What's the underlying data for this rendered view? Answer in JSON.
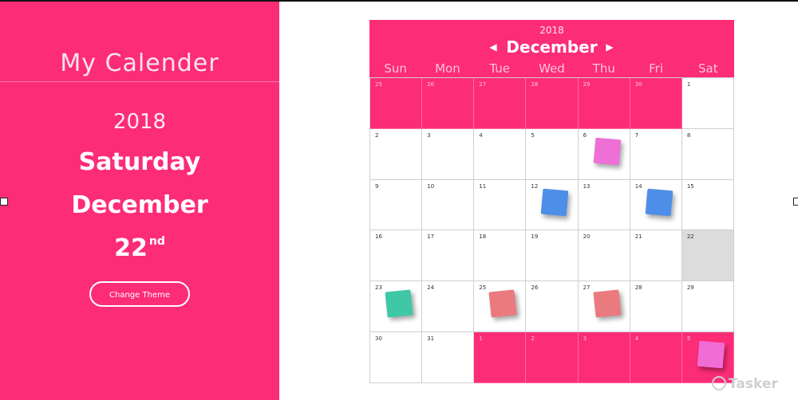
{
  "sidebar": {
    "app_title": "My Calender",
    "year": "2018",
    "weekday": "Saturday",
    "month": "December",
    "day": "22",
    "day_suffix": "nd",
    "theme_button": "Change Theme",
    "background_color": "#fd2c77"
  },
  "calendar": {
    "year": "2018",
    "month": "December",
    "prev_icon": "chevron-left-icon",
    "next_icon": "chevron-right-icon",
    "weekdays": [
      "Sun",
      "Mon",
      "Tue",
      "Wed",
      "Thu",
      "Fri",
      "Sat"
    ],
    "accent_color": "#fd2c77",
    "today_color": "#dcdcdc",
    "cells": [
      {
        "label": "25",
        "muted": true
      },
      {
        "label": "26",
        "muted": true
      },
      {
        "label": "27",
        "muted": true
      },
      {
        "label": "28",
        "muted": true
      },
      {
        "label": "29",
        "muted": true
      },
      {
        "label": "30",
        "muted": true
      },
      {
        "label": "1",
        "muted": false
      },
      {
        "label": "2",
        "muted": false
      },
      {
        "label": "3",
        "muted": false
      },
      {
        "label": "4",
        "muted": false
      },
      {
        "label": "5",
        "muted": false
      },
      {
        "label": "6",
        "muted": false,
        "note": "#ee6fd6"
      },
      {
        "label": "7",
        "muted": false
      },
      {
        "label": "8",
        "muted": false
      },
      {
        "label": "9",
        "muted": false
      },
      {
        "label": "10",
        "muted": false
      },
      {
        "label": "11",
        "muted": false
      },
      {
        "label": "12",
        "muted": false,
        "note": "#4d8fe8"
      },
      {
        "label": "13",
        "muted": false
      },
      {
        "label": "14",
        "muted": false,
        "note": "#4d8fe8"
      },
      {
        "label": "15",
        "muted": false
      },
      {
        "label": "16",
        "muted": false
      },
      {
        "label": "17",
        "muted": false
      },
      {
        "label": "18",
        "muted": false
      },
      {
        "label": "19",
        "muted": false
      },
      {
        "label": "20",
        "muted": false
      },
      {
        "label": "21",
        "muted": false
      },
      {
        "label": "22",
        "muted": false,
        "today": true
      },
      {
        "label": "23",
        "muted": false,
        "note": "#3ec8a6"
      },
      {
        "label": "24",
        "muted": false
      },
      {
        "label": "25",
        "muted": false,
        "note": "#ea7a7e"
      },
      {
        "label": "26",
        "muted": false
      },
      {
        "label": "27",
        "muted": false,
        "note": "#ea7a7e"
      },
      {
        "label": "28",
        "muted": false
      },
      {
        "label": "29",
        "muted": false
      },
      {
        "label": "30",
        "muted": false
      },
      {
        "label": "31",
        "muted": false
      },
      {
        "label": "1",
        "muted": true
      },
      {
        "label": "2",
        "muted": true
      },
      {
        "label": "3",
        "muted": true
      },
      {
        "label": "4",
        "muted": true
      },
      {
        "label": "5",
        "muted": true,
        "note": "#f26cd6"
      }
    ]
  },
  "watermark": "Tasker"
}
